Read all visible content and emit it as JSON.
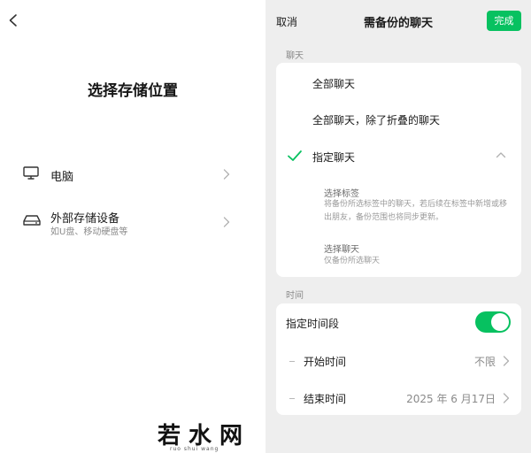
{
  "left": {
    "title": "选择存储位置",
    "rows": [
      {
        "label": "电脑",
        "icon": "monitor-icon"
      },
      {
        "label": "外部存储设备",
        "subtitle": "如U盘、移动硬盘等",
        "icon": "external-drive-icon"
      }
    ]
  },
  "right": {
    "cancel": "取消",
    "title": "需备份的聊天",
    "done": "完成",
    "chat_section": "聊天",
    "options": {
      "all": "全部聊天",
      "all_except_folded": "全部聊天，除了折叠的聊天",
      "specified": "指定聊天"
    },
    "selected_option": "指定聊天",
    "sub_options": {
      "tags_title": "选择标签",
      "tags_desc": "将备份所选标签中的聊天，若后续在标签中新增或移出朋友，备份范围也将同步更新。",
      "chats_title": "选择聊天",
      "chats_desc": "仅备份所选聊天"
    },
    "time_section": "时间",
    "time_range_label": "指定时间段",
    "time_range_enabled": true,
    "start_label": "开始时间",
    "start_value": "不限",
    "end_label": "结束时间",
    "end_value": "2025 年 6 月17日"
  },
  "colors": {
    "accent": "#07c160",
    "panel_bg": "#eeeeee"
  }
}
